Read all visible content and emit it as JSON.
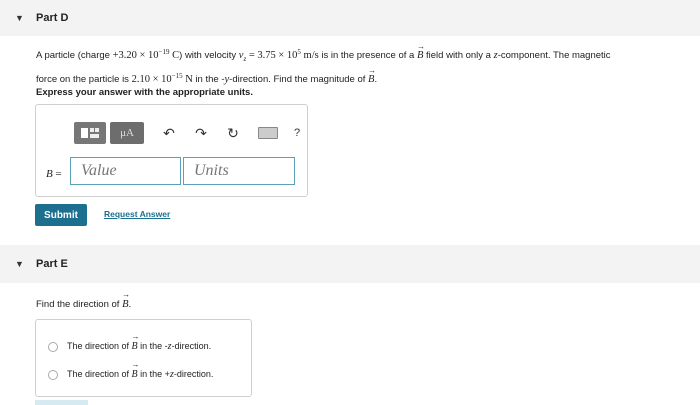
{
  "partD": {
    "label": "Part D",
    "question_line1_a": "A particle (charge ",
    "charge": "+3.20 × 10",
    "charge_exp": "−19",
    "charge_unit": " C",
    "question_line1_b": ") with velocity ",
    "vel_var": "v",
    "vel_sub": "z",
    "vel_eq": " = 3.75 × 10",
    "vel_exp": "5",
    "vel_unit": " m/s",
    "question_line1_c": " is in the presence of a ",
    "B": "B",
    "question_line1_d": " field with only a ",
    "zcomp": "z",
    "question_line1_e": "-component. The magnetic",
    "question_line2_a": "force on the particle is ",
    "force": "2.10 × 10",
    "force_exp": "−15",
    "force_unit": " N",
    "question_line2_b": " in the -",
    "ydir": "y",
    "question_line2_c": "-direction. Find the magnitude of ",
    "question_line2_d": ".",
    "instruction": "Express your answer with the appropriate units.",
    "toolbar": {
      "mu_label": "μA",
      "help_label": "?"
    },
    "answer_var": "B",
    "answer_eq": " =",
    "value_placeholder": "Value",
    "units_placeholder": "Units",
    "submit_label": "Submit",
    "request_label": "Request Answer"
  },
  "partE": {
    "label": "Part E",
    "question_a": "Find the direction of ",
    "question_b": ".",
    "choices": [
      {
        "pre": "The direction of ",
        "post": " in the -",
        "axis": "z",
        "end": "-direction."
      },
      {
        "pre": "The direction of ",
        "post": " in the +",
        "axis": "z",
        "end": "-direction."
      }
    ]
  },
  "colors": {
    "accent": "#1d6f8f",
    "input_border": "#5aa0ba",
    "header_bg": "#f3f3f3"
  }
}
